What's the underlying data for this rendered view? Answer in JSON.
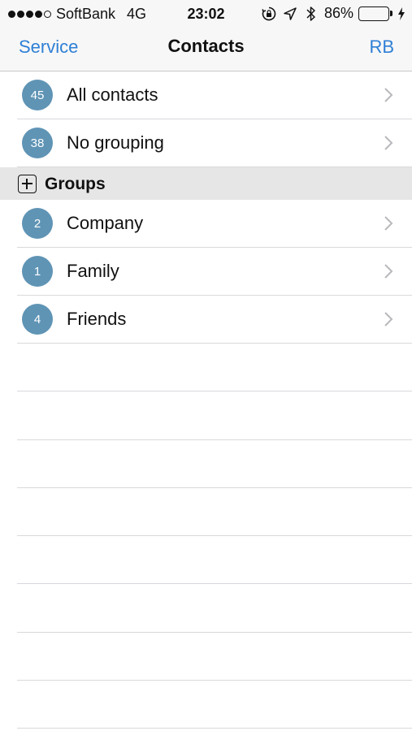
{
  "status_bar": {
    "carrier": "SoftBank",
    "network": "4G",
    "time": "23:02",
    "battery_percent": "86%",
    "battery_level": 0.86,
    "icons": [
      "rotation-lock-icon",
      "location-arrow-icon",
      "bluetooth-icon",
      "charging-bolt-icon"
    ]
  },
  "nav": {
    "left_label": "Service",
    "title": "Contacts",
    "right_label": "RB"
  },
  "top_items": [
    {
      "count": "45",
      "label": "All contacts"
    },
    {
      "count": "38",
      "label": "No grouping"
    }
  ],
  "groups_section": {
    "label": "Groups",
    "icon": "plus-square-icon"
  },
  "group_items": [
    {
      "count": "2",
      "label": "Company"
    },
    {
      "count": "1",
      "label": "Family"
    },
    {
      "count": "4",
      "label": "Friends"
    }
  ],
  "colors": {
    "accent": "#2e7fd6",
    "badge": "#5f94b5",
    "battery_fill": "#4cd964",
    "section_bg": "#e6e6e6"
  }
}
